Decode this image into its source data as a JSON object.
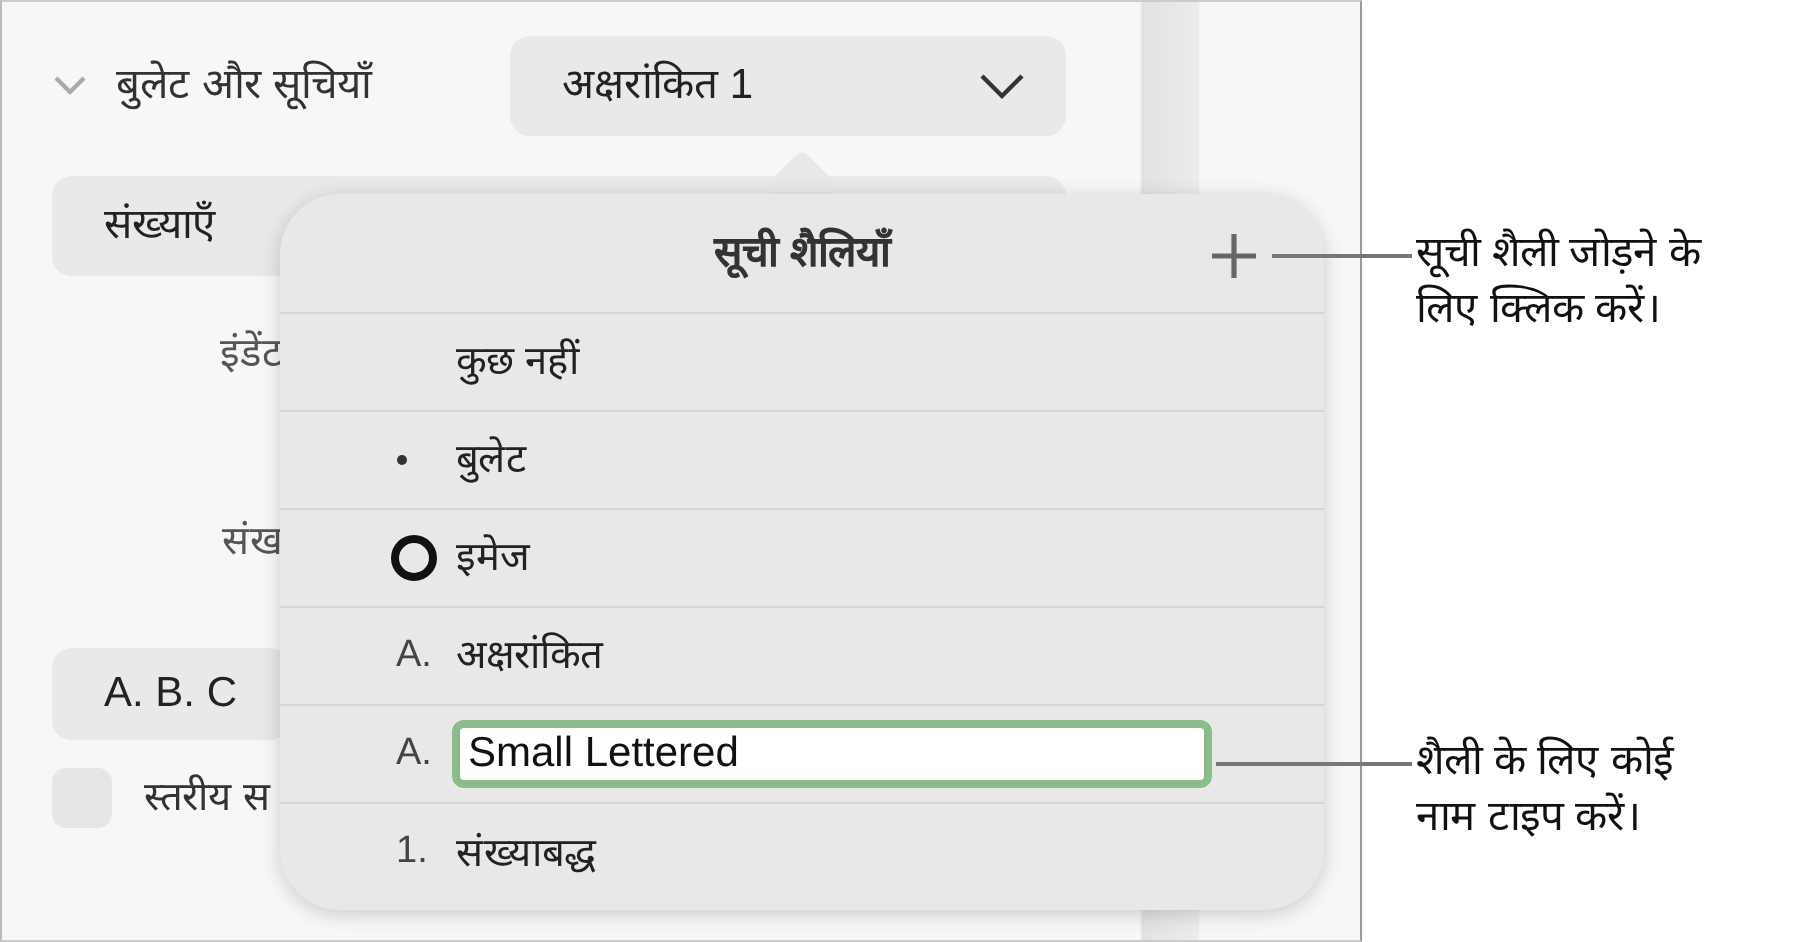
{
  "panel": {
    "section": {
      "title": "बुलेट और सूचियाँ",
      "expanded": true,
      "style_popup": "अक्षरांकित 1"
    },
    "type_popup": "संख्याएँ",
    "indent_label": "इंडेंट",
    "number_label": "संख",
    "format_popup": "A. B. C",
    "tiered_checkbox": {
      "label": "स्तरीय स",
      "checked": false
    }
  },
  "popover": {
    "title": "सूची शैलियाँ",
    "styles": [
      {
        "kind": "none",
        "label": "कुछ नहीं",
        "editing": false
      },
      {
        "kind": "bullet",
        "label": "बुलेट",
        "editing": false
      },
      {
        "kind": "image",
        "label": "इमेज",
        "editing": false
      },
      {
        "kind": "text",
        "prefix": "A.",
        "label": "अक्षरांकित",
        "editing": false
      },
      {
        "kind": "text",
        "prefix": "A.",
        "label": "Small Lettered",
        "editing": true
      },
      {
        "kind": "text",
        "prefix": "1.",
        "label": "संख्याबद्ध",
        "editing": false
      }
    ]
  },
  "callouts": [
    {
      "text": "सूची शैली जोड़ने के लिए क्लिक करें।"
    },
    {
      "text": "शैली के लिए कोई नाम टाइप करें।"
    }
  ]
}
